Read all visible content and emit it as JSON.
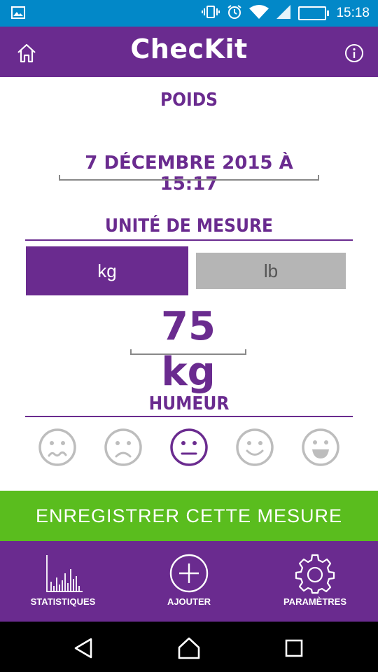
{
  "status_bar": {
    "battery_percent": "61 %",
    "battery_level": 0.61,
    "time": "15:18",
    "icons": [
      "image-notification-icon",
      "vibrate-icon",
      "alarm-icon",
      "wifi-icon",
      "cell-signal-icon",
      "battery-icon"
    ]
  },
  "header": {
    "title": "ChecKit",
    "home_icon": "home-icon",
    "info_icon": "info-icon"
  },
  "main": {
    "section_title": "POIDS",
    "date": "7 DÉCEMBRE 2015 À 15:17",
    "unit_title": "UNITÉ DE MESURE",
    "units": [
      {
        "label": "kg",
        "selected": true
      },
      {
        "label": "lb",
        "selected": false
      }
    ],
    "weight": "75 kg",
    "mood_title": "HUMEUR",
    "moods": [
      {
        "icon": "very-sad-face-icon",
        "selected": false
      },
      {
        "icon": "sad-face-icon",
        "selected": false
      },
      {
        "icon": "neutral-face-icon",
        "selected": true
      },
      {
        "icon": "happy-face-icon",
        "selected": false
      },
      {
        "icon": "very-happy-face-icon",
        "selected": false
      }
    ]
  },
  "save_button": "ENREGISTRER CETTE MESURE",
  "bottom_nav": [
    {
      "label": "STATISTIQUES",
      "icon": "bar-chart-icon"
    },
    {
      "label": "AJOUTER",
      "icon": "add-circle-icon"
    },
    {
      "label": "PARAMÈTRES",
      "icon": "gear-icon"
    }
  ],
  "system_nav": [
    "back-icon",
    "home-icon",
    "recents-icon"
  ],
  "colors": {
    "primary": "#6a2b8f",
    "status_bar": "#0288c8",
    "save": "#5abd1e",
    "unselected_unit": "#b5b5b5",
    "mood_inactive": "#bdbdbd"
  }
}
